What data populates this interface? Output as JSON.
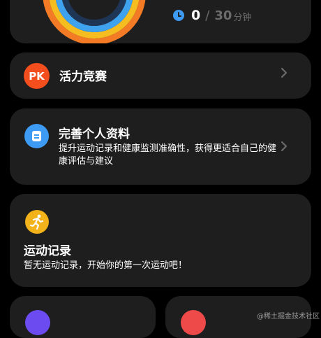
{
  "activity": {
    "current": "0",
    "separator": "/",
    "target": "30",
    "unit": "分钟"
  },
  "pk": {
    "badge": "PK",
    "title": "活力竞赛"
  },
  "profile": {
    "title": "完善个人资料",
    "description": "提升运动记录和健康监测准确性，获得更适合自己的健康评估与建议"
  },
  "exercise": {
    "title": "运动记录",
    "empty_text": "暂无运动记录，开始你的第一次运动吧！"
  },
  "watermark": "@稀土掘金技术社区",
  "colors": {
    "background": "#000000",
    "card": "#1e1e1e",
    "pk_badge": "#f24e1e",
    "profile_icon": "#3d9bf4",
    "run_icon": "#f2b21a",
    "clock_icon": "#3d9bf4",
    "muted_text": "#6b6b6b"
  },
  "icons": {
    "clock": "clock-icon",
    "pk": "pk-badge-icon",
    "profile": "document-icon",
    "exercise": "running-person-icon",
    "chevron": "chevron-right-icon"
  }
}
